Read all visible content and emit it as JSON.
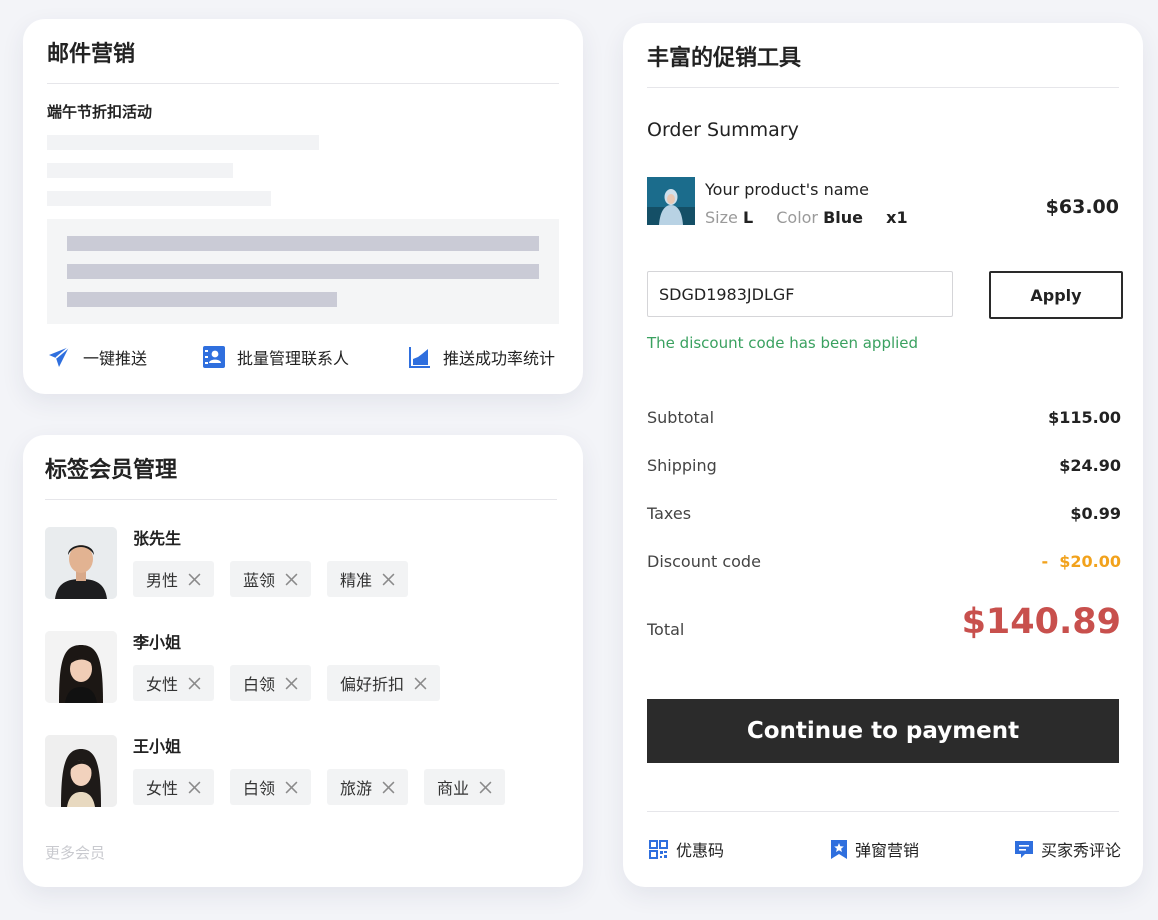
{
  "email_card": {
    "title": "邮件营销",
    "campaign_name": "端午节折扣活动",
    "actions": [
      {
        "label": "一键推送",
        "icon": "paper-plane-icon"
      },
      {
        "label": "批量管理联系人",
        "icon": "contact-book-icon"
      },
      {
        "label": "推送成功率统计",
        "icon": "area-chart-icon"
      }
    ]
  },
  "tags_card": {
    "title": "标签会员管理",
    "members": [
      {
        "name": "张先生",
        "tags": [
          "男性",
          "蓝领",
          "精准"
        ]
      },
      {
        "name": "李小姐",
        "tags": [
          "女性",
          "白领",
          "偏好折扣"
        ]
      },
      {
        "name": "王小姐",
        "tags": [
          "女性",
          "白领",
          "旅游",
          "商业"
        ]
      }
    ],
    "more_label": "更多会员"
  },
  "promo_card": {
    "title": "丰富的促销工具",
    "order_summary_title": "Order Summary",
    "product": {
      "name": "Your product's name",
      "size_label": "Size",
      "size_value": "L",
      "color_label": "Color",
      "color_value": "Blue",
      "qty": "x1",
      "price": "$63.00"
    },
    "discount": {
      "code_value": "SDGD1983JDLGF",
      "apply_label": "Apply",
      "applied_message": "The discount code has been applied"
    },
    "summary_rows": [
      {
        "label": "Subtotal",
        "value": "$115.00"
      },
      {
        "label": "Shipping",
        "value": "$24.90"
      },
      {
        "label": "Taxes",
        "value": "$0.99"
      },
      {
        "label": "Discount code",
        "value": "-  $20.00"
      }
    ],
    "total_label": "Total",
    "total_value": "$140.89",
    "pay_label": "Continue to payment",
    "tools": [
      {
        "label": "优惠码",
        "icon": "qr-code-icon"
      },
      {
        "label": "弹窗营销",
        "icon": "bookmark-star-icon"
      },
      {
        "label": "买家秀评论",
        "icon": "comment-icon"
      }
    ]
  },
  "colors": {
    "accent_blue": "#2f6fde",
    "success_green": "#3aa160",
    "discount_orange": "#f2a21c",
    "total_red": "#c8504d",
    "button_dark": "#2b2b2b"
  }
}
